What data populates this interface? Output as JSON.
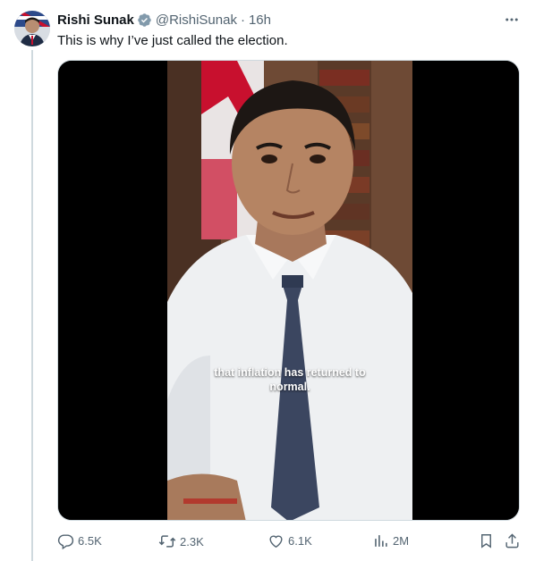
{
  "tweet": {
    "display_name": "Rishi Sunak",
    "handle": "@RishiSunak",
    "separator": "·",
    "time": "16h",
    "text": "This is why I’ve just called the election.",
    "verified_icon": "verified-badge-icon",
    "more_icon": "more-options-icon"
  },
  "media": {
    "caption_line1": "that inflation has returned to",
    "caption_line2": "normal."
  },
  "actions": {
    "replies": "6.5K",
    "reposts": "2.3K",
    "likes": "6.1K",
    "views": "2M"
  },
  "colors": {
    "verified": "#829aab",
    "secondary_text": "#536471",
    "thread_line": "#cfd9de"
  }
}
